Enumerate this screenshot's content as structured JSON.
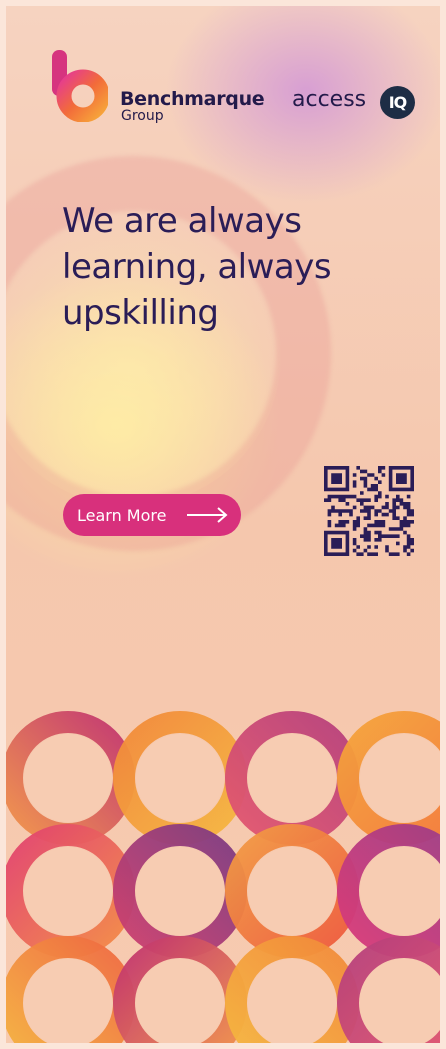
{
  "brand": {
    "name": "Benchmarque",
    "sub": "Group",
    "partner_prefix": "access",
    "partner_badge": "IQ"
  },
  "headline": {
    "line1": "We are always",
    "line2": "learning, always",
    "line3": "upskilling"
  },
  "cta": {
    "label": "Learn More"
  },
  "icons": {
    "logo": "benchmarque-b-logo-icon",
    "arrow": "arrow-right-icon",
    "qr": "qr-code-icon"
  },
  "colors": {
    "navy": "#2a1d57",
    "cta_pink": "#d8307c",
    "background_peach": "#f6d3c0"
  }
}
